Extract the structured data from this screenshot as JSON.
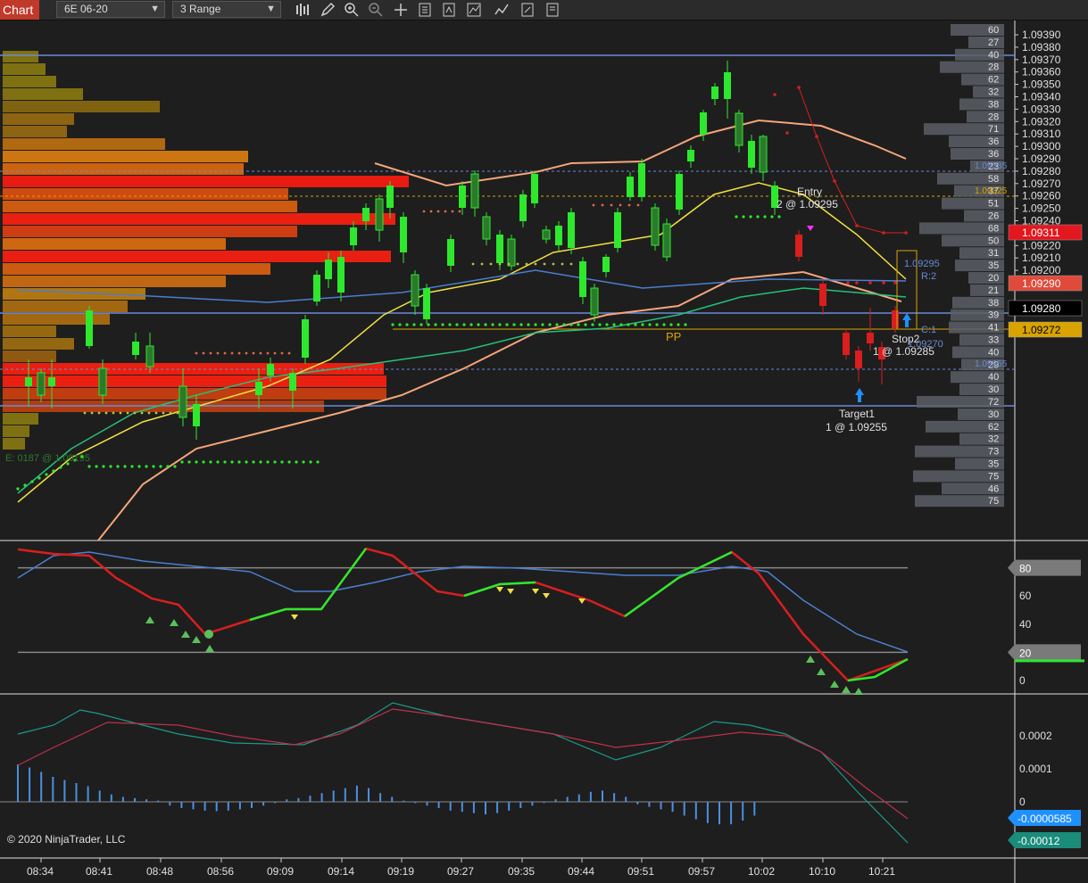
{
  "toolbar": {
    "tab_label": "Chart",
    "instrument": "6E 06-20",
    "bar_type": "3 Range",
    "icons": [
      "bar-style-icon",
      "draw-pencil-icon",
      "zoom-in-icon",
      "zoom-out-icon",
      "crosshair-icon",
      "properties-icon",
      "strategies-icon",
      "indicators-icon",
      "templates-icon",
      "more-menu-icon"
    ]
  },
  "price_axis": {
    "labels": [
      "1.09390",
      "1.09380",
      "1.09370",
      "1.09360",
      "1.09350",
      "1.09340",
      "1.09330",
      "1.09320",
      "1.09310",
      "1.09300",
      "1.09290",
      "1.09280",
      "1.09270",
      "1.09260",
      "1.09250",
      "1.09240",
      "1.09230",
      "1.09220",
      "1.09210",
      "1.09200",
      "1.09190"
    ],
    "badges": [
      {
        "text": "1.09311",
        "color": "#e3171e",
        "text_color": "#ffffff"
      },
      {
        "text": "1.09290",
        "color": "#e04a3a",
        "text_color": "#ffffff"
      },
      {
        "text": "1.09280",
        "color": "#000000",
        "text_color": "#ffffff"
      },
      {
        "text": "1.09272",
        "color": "#d9a400",
        "text_color": "#000000"
      }
    ]
  },
  "volume_ladder": [
    "60",
    "27",
    "40",
    "28",
    "62",
    "32",
    "38",
    "28",
    "71",
    "36",
    "36",
    "23",
    "58",
    "37",
    "51",
    "26",
    "68",
    "50",
    "31",
    "35",
    "20",
    "21",
    "38",
    "39",
    "41",
    "33",
    "40",
    "29",
    "40",
    "30",
    "72",
    "30",
    "62",
    "32",
    "73",
    "35",
    "75",
    "46",
    "75"
  ],
  "chart_labels": {
    "entry": "Entry",
    "entry_fill": "2 @ 1.09295",
    "stop": "Stop2",
    "stop_fill": "1 @ 1.09285",
    "target": "Target1",
    "target_fill": "1 @ 1.09255",
    "pp": "PP",
    "level_a": "1.09295",
    "r2": "R:2",
    "c1": "C:1",
    "level_b": "1.09270",
    "level_335": "1.09335",
    "level_325": "1.09325",
    "level_255": "1.09255",
    "vwap_label": "E: 0187  @ 1.09195"
  },
  "stoch_panel": {
    "axis_labels": [
      "60",
      "40",
      "0"
    ],
    "badges": [
      {
        "text": "80",
        "color": "#7a7a7a"
      },
      {
        "text": "20",
        "color": "#7a7a7a"
      }
    ]
  },
  "macd_panel": {
    "axis_labels": [
      "0.0002",
      "0.0001",
      "0"
    ],
    "badges": [
      {
        "text": "-0.0000585",
        "color": "#1e90ff"
      },
      {
        "text": "-0.00012",
        "color": "#1a8c7a"
      }
    ]
  },
  "time_axis": [
    "08:34",
    "08:41",
    "08:48",
    "08:56",
    "09:09",
    "09:14",
    "09:19",
    "09:27",
    "09:35",
    "09:44",
    "09:51",
    "09:57",
    "10:02",
    "10:10",
    "10:21"
  ],
  "copyright": "© 2020 NinjaTrader, LLC",
  "colors": {
    "bg": "#1e1e1e",
    "bull": "#2ee82e",
    "bear": "#d91e1e",
    "grid_line": "#6a8ad8",
    "ema_fast": "#f0e040",
    "ema_mid": "#25c07a",
    "ema_slow": "#f5a57a",
    "sma_blue": "#4a7fd0"
  }
}
